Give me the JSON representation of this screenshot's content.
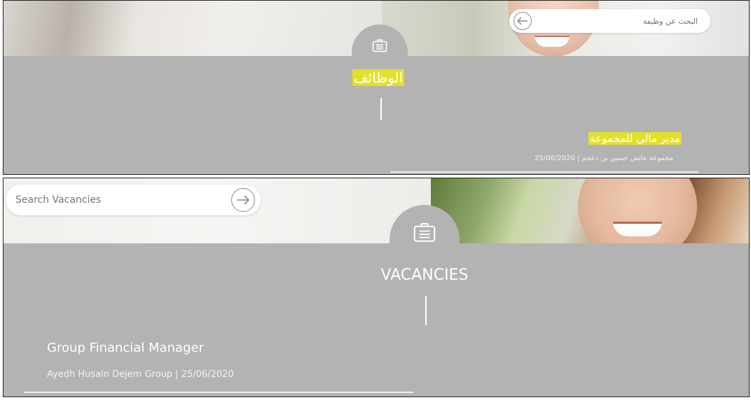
{
  "arabic_panel": {
    "search_placeholder": "البحث عن وظيفة",
    "section_title": "الوظائف",
    "job": {
      "title": "مدير مالي للمجموعة",
      "meta": "مجموعة عائض حسين بن دعجم | 25/06/2020"
    }
  },
  "english_panel": {
    "search_placeholder": "Search Vacancies",
    "section_title": "VACANCIES",
    "job": {
      "title": "Group Financial Manager",
      "meta": "Ayedh Husain Dejem Group | 25/06/2020"
    }
  },
  "icons": {
    "search_arrow_rtl": "arrow-left-icon",
    "search_arrow_ltr": "arrow-right-icon",
    "section_icon": "briefcase-icon"
  },
  "colors": {
    "panel_gray": "#b3b3b3",
    "highlight": "#e3e02a",
    "text_white": "#ffffff"
  }
}
